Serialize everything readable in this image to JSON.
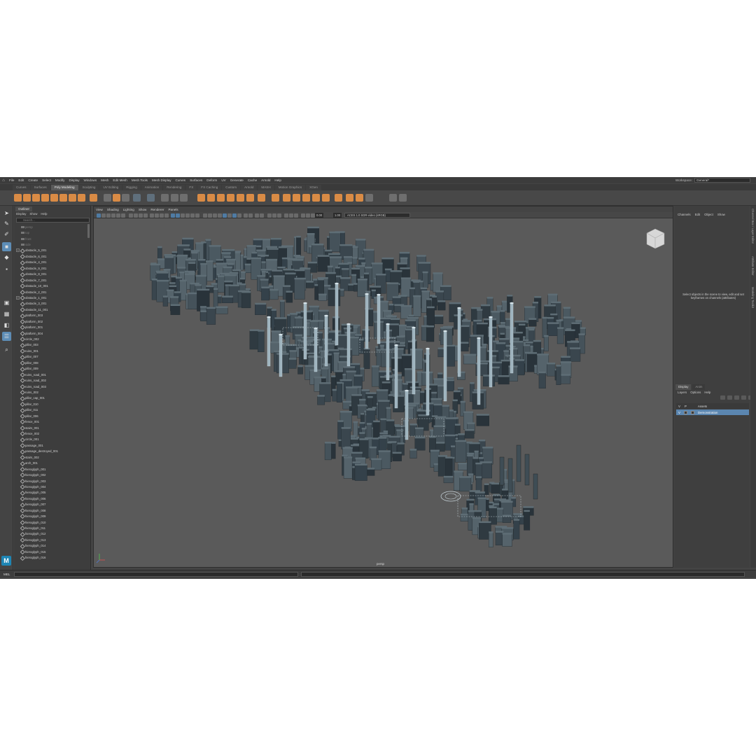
{
  "menubar": [
    "File",
    "Edit",
    "Create",
    "Select",
    "Modify",
    "Display",
    "Windows",
    "Mesh",
    "Edit Mesh",
    "Mesh Tools",
    "Mesh Display",
    "Curves",
    "Surfaces",
    "Deform",
    "UV",
    "Generate",
    "Cache",
    "Arnold",
    "Help"
  ],
  "workspace": {
    "label": "Workspace:",
    "value": "General*"
  },
  "shelf_tabs": [
    "Curves",
    "Surfaces",
    "Poly Modeling",
    "Sculpting",
    "UV Editing",
    "Rigging",
    "Animation",
    "Rendering",
    "FX",
    "FX Caching",
    "Custom",
    "Arnold",
    "MASH",
    "Motion Graphics",
    "XGen"
  ],
  "shelf_active": "Poly Modeling",
  "outliner": {
    "tab": "Outliner",
    "menu": [
      "Display",
      "Show",
      "Help"
    ],
    "search_placeholder": "Search...",
    "cameras": [
      "persp",
      "top",
      "front",
      "side"
    ],
    "items": [
      "obstacle_5_001",
      "obstacle_6_001",
      "obstacle_4_001",
      "obstacle_9_001",
      "obstacle_8_001",
      "obstacle_7_001",
      "obstacle_10_001",
      "obstacle_2_001",
      "obstacle_1_001",
      "obstacle_3_001",
      "obstacle_11_001",
      "platform_003",
      "platform_002",
      "platform_001",
      "platform_004",
      "circle_002",
      "pillar_003",
      "ruins_001",
      "pillar_007",
      "pillar_008",
      "pillar_009",
      "ruins_road_001",
      "ruins_road_002",
      "ruins_road_003",
      "ruins_002",
      "pillar_cap_001",
      "pillar_010",
      "pillar_011",
      "pillar_006",
      "fence_001",
      "stairs_001",
      "fence_002",
      "circle_001",
      "passage_001",
      "passage_destroyed_001",
      "stairs_002",
      "arch_001",
      "hieroglyph_001",
      "hieroglyph_002",
      "hieroglyph_003",
      "hieroglyph_004",
      "hieroglyph_005",
      "hieroglyph_006",
      "hieroglyph_007",
      "hieroglyph_008",
      "hieroglyph_009",
      "hieroglyph_010",
      "hieroglyph_011",
      "hieroglyph_012",
      "hieroglyph_013",
      "hieroglyph_014",
      "hieroglyph_015",
      "hieroglyph_016"
    ],
    "expandable": [
      "obstacle_5_001",
      "obstacle_1_001"
    ]
  },
  "viewport": {
    "menu": [
      "View",
      "Shading",
      "Lighting",
      "Show",
      "Renderer",
      "Panels"
    ],
    "value_a": "0.00",
    "value_b": "1.00",
    "color_space": "ACES 1.0 SDR-video (sRGB)",
    "camera_label": "persp"
  },
  "channel_box": {
    "menu": [
      "Channels",
      "Edit",
      "Object",
      "Show"
    ],
    "message": "Select objects in the scene to view, edit and set keyframes on channels (attributes)"
  },
  "layers": {
    "tabs": [
      "Display",
      "Anim"
    ],
    "menu": [
      "Layers",
      "Options",
      "Help"
    ],
    "header_v": "V",
    "header_p": "P",
    "header_name": "Assets",
    "layer_name": "Demonstration",
    "layer_v": "V"
  },
  "side_tabs": [
    "Channel Box / Layer Editor",
    "Attribute Editor",
    "Modeling Toolkit"
  ],
  "command_line": {
    "label": "MEL"
  },
  "colors": {
    "accent": "#5b86b0",
    "shelf_icon": "#d98b45",
    "building": "#3e4a52"
  }
}
